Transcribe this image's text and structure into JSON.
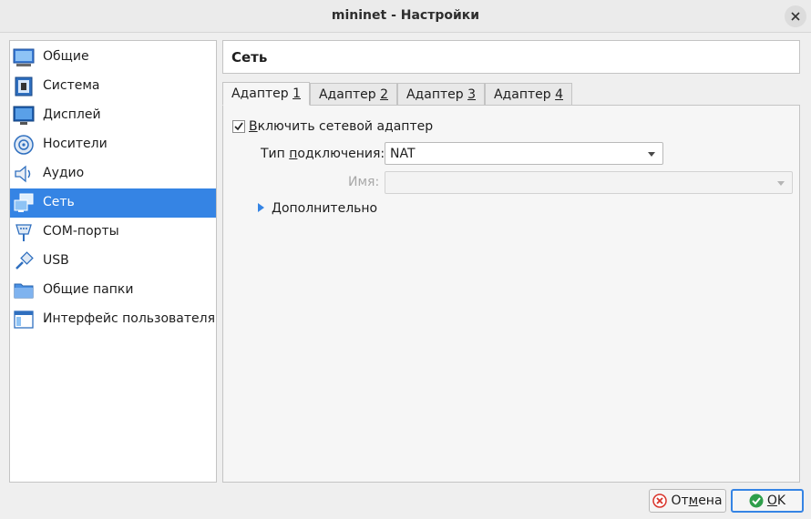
{
  "window": {
    "title": "mininet - Настройки"
  },
  "sidebar": {
    "items": [
      {
        "label": "Общие",
        "icon": "general-icon"
      },
      {
        "label": "Система",
        "icon": "system-icon"
      },
      {
        "label": "Дисплей",
        "icon": "display-icon"
      },
      {
        "label": "Носители",
        "icon": "storage-icon"
      },
      {
        "label": "Аудио",
        "icon": "audio-icon"
      },
      {
        "label": "Сеть",
        "icon": "network-icon",
        "selected": true
      },
      {
        "label": "COM-порты",
        "icon": "serial-ports-icon"
      },
      {
        "label": "USB",
        "icon": "usb-icon"
      },
      {
        "label": "Общие папки",
        "icon": "shared-folder-icon"
      },
      {
        "label": "Интерфейс пользователя",
        "icon": "user-interface-icon"
      }
    ]
  },
  "main": {
    "header": "Сеть",
    "tabs": [
      {
        "prefix": "Адаптер ",
        "mnemonic": "1",
        "selected": true
      },
      {
        "prefix": "Адаптер ",
        "mnemonic": "2"
      },
      {
        "prefix": "Адаптер ",
        "mnemonic": "3"
      },
      {
        "prefix": "Адаптер ",
        "mnemonic": "4"
      }
    ],
    "enable_adapter": {
      "mnemonic": "В",
      "rest": "ключить сетевой адаптер",
      "checked": true
    },
    "attachment": {
      "label_pre": "Тип ",
      "label_mnemonic": "п",
      "label_post": "одключения:",
      "value": "NAT"
    },
    "name": {
      "label": "Имя:",
      "value": "",
      "disabled": true
    },
    "advanced": {
      "mnemonic": "Д",
      "rest": "ополнительно"
    }
  },
  "buttons": {
    "cancel": {
      "pre": "От",
      "mnemonic": "м",
      "post": "ена",
      "icon": "cancel-icon"
    },
    "ok": {
      "mnemonic": "О",
      "post": "K",
      "icon": "ok-icon"
    }
  },
  "colors": {
    "accent": "#3584e4",
    "window_bg": "#efefef",
    "selected_text": "#ffffff"
  }
}
